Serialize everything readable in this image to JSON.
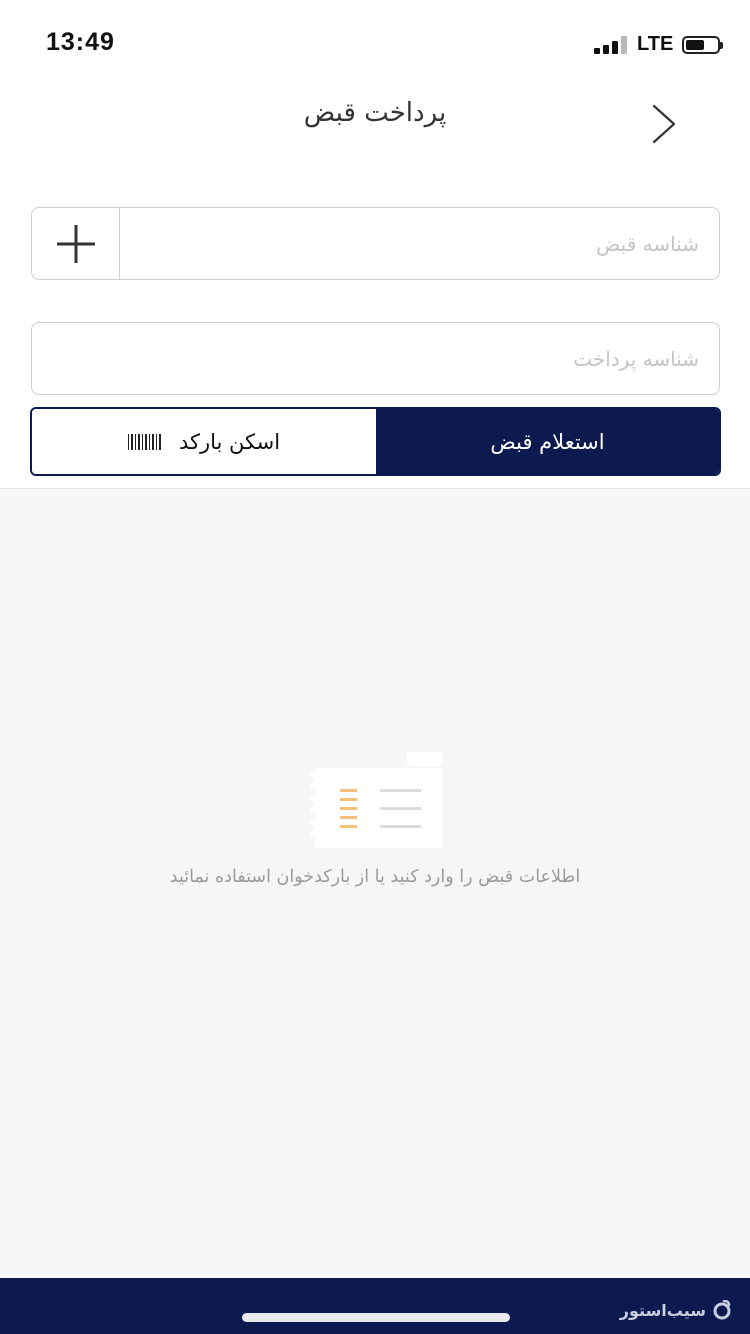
{
  "status_bar": {
    "time": "13:49",
    "network": "LTE",
    "battery_level": 0.6
  },
  "header": {
    "title": "پرداخت قبض",
    "back_icon": "chevron-right-icon"
  },
  "form": {
    "bill_id": {
      "placeholder": "شناسه قبض",
      "value": ""
    },
    "payment_id": {
      "placeholder": "شناسه پرداخت",
      "value": ""
    },
    "add_icon": "plus-icon"
  },
  "actions": {
    "scan_label": "اسکن بارکد",
    "scan_icon": "barcode-icon",
    "inquiry_label": "استعلام قبض"
  },
  "empty_state": {
    "icon": "bill-receipt-icon",
    "message": "اطلاعات قبض را وارد کنید یا از بارکدخوان استفاده نمائید"
  },
  "watermark": {
    "text": "سیب‌استور"
  },
  "colors": {
    "primary": "#0c1a4f",
    "background_empty": "#f6f6f6",
    "accent_lines": "#f5c07a"
  }
}
